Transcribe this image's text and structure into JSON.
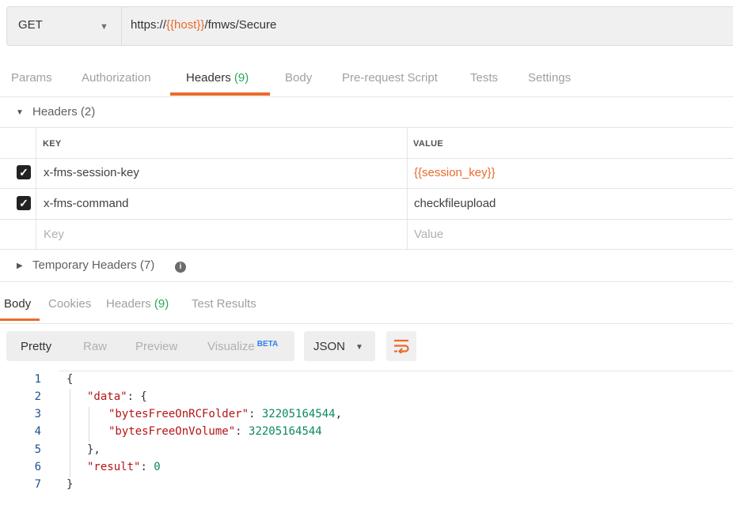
{
  "request": {
    "method": "GET",
    "url_prefix": "https://",
    "url_var": "{{host}}",
    "url_suffix": "/fmws/Secure"
  },
  "request_tabs": [
    {
      "label": "Params"
    },
    {
      "label": "Authorization"
    },
    {
      "label": "Headers",
      "count": "(9)"
    },
    {
      "label": "Body"
    },
    {
      "label": "Pre-request Script"
    },
    {
      "label": "Tests"
    },
    {
      "label": "Settings"
    }
  ],
  "headers_section": {
    "title": "Headers (2)",
    "col_key": "KEY",
    "col_value": "VALUE",
    "rows": [
      {
        "key": "x-fms-session-key",
        "value": "{{session_key}}",
        "checked": true
      },
      {
        "key": "x-fms-command",
        "value": "checkfileupload",
        "checked": true
      }
    ],
    "placeholder_key": "Key",
    "placeholder_value": "Value"
  },
  "temporary_headers": {
    "title": "Temporary Headers (7)"
  },
  "response_tabs": [
    {
      "label": "Body"
    },
    {
      "label": "Cookies"
    },
    {
      "label": "Headers",
      "count": "(9)"
    },
    {
      "label": "Test Results"
    }
  ],
  "view_modes": [
    {
      "label": "Pretty"
    },
    {
      "label": "Raw"
    },
    {
      "label": "Preview"
    },
    {
      "label": "Visualize",
      "badge": "BETA"
    }
  ],
  "format": "JSON",
  "icons": {
    "method_dropdown": "chevron-down-icon",
    "headers_toggle": "triangle-down-icon",
    "temp_toggle": "triangle-right-icon",
    "info": "info-icon",
    "wrap": "wrap-lines-icon",
    "format_dropdown": "chevron-down-icon"
  },
  "colors": {
    "accent": "#e96b2c",
    "count": "#26a85a",
    "json_key": "#b41414",
    "json_number": "#0a8a5a",
    "line_number": "#1d4f91",
    "beta": "#2f80ed"
  },
  "code": {
    "line_numbers": [
      "1",
      "2",
      "3",
      "4",
      "5",
      "6",
      "7"
    ],
    "open_brace": "{",
    "data_key": "\"data\"",
    "data_open": ": {",
    "bytes_rc_key": "\"bytesFreeOnRCFolder\"",
    "bytes_rc_value": "32205164544",
    "bytes_vol_key": "\"bytesFreeOnVolume\"",
    "bytes_vol_value": "32205164544",
    "data_close": "},",
    "result_key": "\"result\"",
    "result_value": "0",
    "close_brace": "}"
  }
}
